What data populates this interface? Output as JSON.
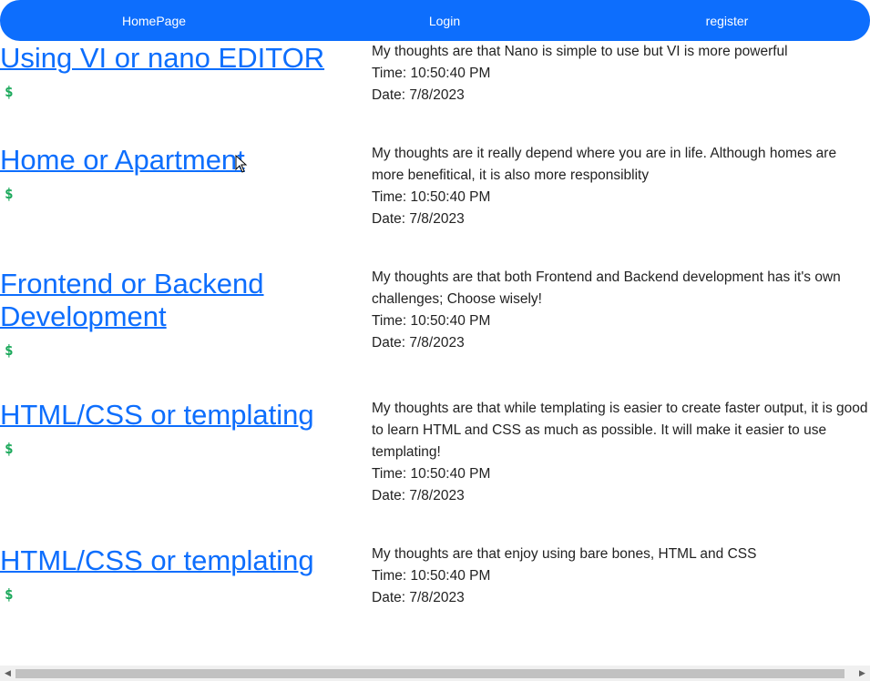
{
  "nav": {
    "home": "HomePage",
    "login": "Login",
    "register": "register",
    "color": "#0d6efd"
  },
  "posts": [
    {
      "title": "Using VI or nano EDITOR",
      "icon": "dollar-sign-icon",
      "icon_glyph": "$",
      "body": "My thoughts are that Nano is simple to use but VI is more powerful",
      "time": "Time: 10:50:40 PM",
      "date": "Date: 7/8/2023"
    },
    {
      "title": "Home or Apartment",
      "icon": "dollar-sign-icon",
      "icon_glyph": "$",
      "body": "My thoughts are it really depend where you are in life. Although homes are more benefitical, it is also more responsiblity",
      "time": "Time: 10:50:40 PM",
      "date": "Date: 7/8/2023"
    },
    {
      "title": "Frontend or Backend Development",
      "icon": "dollar-sign-icon",
      "icon_glyph": "$",
      "body": "My thoughts are that both Frontend and Backend development has it's own challenges; Choose wisely!",
      "time": "Time: 10:50:40 PM",
      "date": "Date: 7/8/2023"
    },
    {
      "title": "HTML/CSS or templating",
      "icon": "dollar-sign-icon",
      "icon_glyph": "$",
      "body": "My thoughts are that while templating is easier to create faster output, it is good to learn HTML and CSS as much as possible. It will make it easier to use templating!",
      "time": "Time: 10:50:40 PM",
      "date": "Date: 7/8/2023"
    },
    {
      "title": "HTML/CSS or templating",
      "icon": "dollar-sign-icon",
      "icon_glyph": "$",
      "body": "My thoughts are that enjoy using bare bones, HTML and CSS",
      "time": "Time: 10:50:40 PM",
      "date": "Date: 7/8/2023"
    }
  ],
  "scrollbar": {
    "left_arrow": "◀",
    "right_arrow": "▶"
  }
}
